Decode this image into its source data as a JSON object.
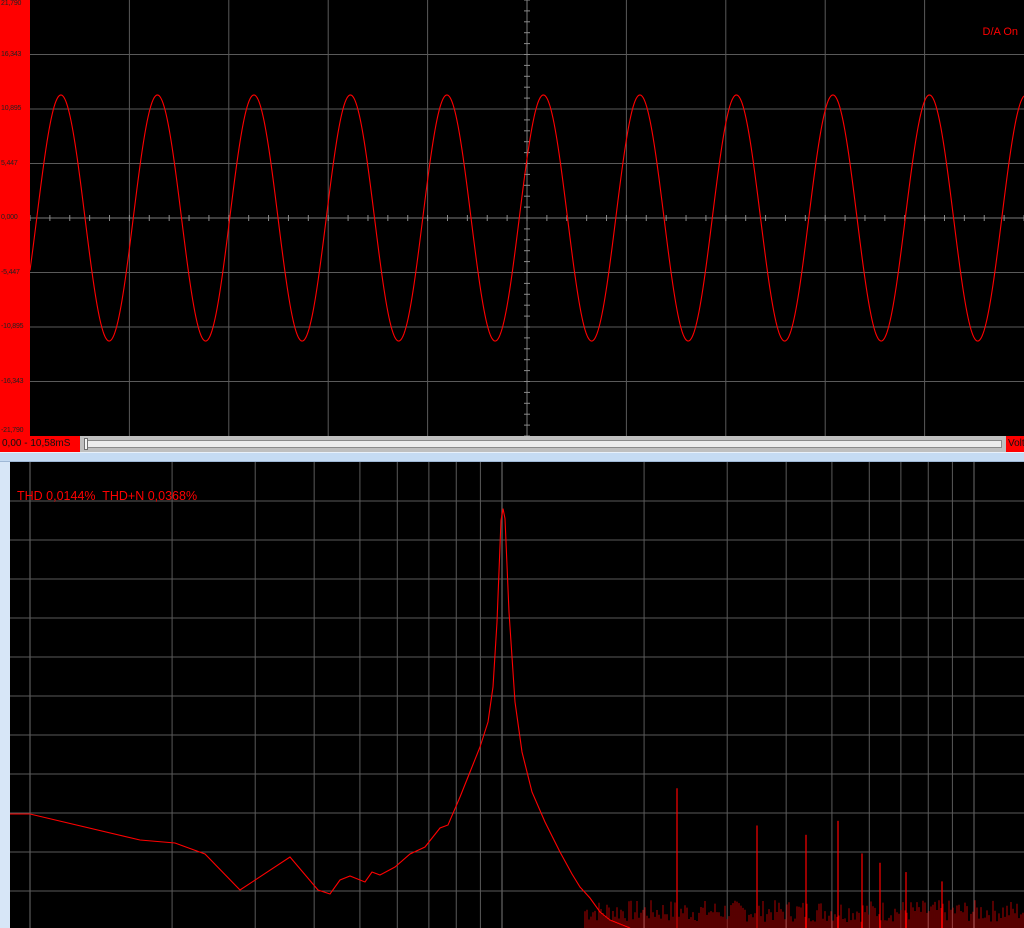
{
  "scope": {
    "y_ticks": [
      "21,790",
      "16,343",
      "10,895",
      "5,447",
      "0,000",
      "-5,447",
      "-10,895",
      "-16,343",
      "-21,790"
    ],
    "status": "D/A On",
    "time_range": "0,00 - 10,58mS",
    "units": "Volt",
    "time_scroll_position": 0.0
  },
  "spectrum": {
    "readout": "THD 0,0144%  THD+N 0,0368%"
  },
  "colors": {
    "trace": "#ff0000",
    "grid": "#5a5a5a",
    "axis_bar": "#ff0000",
    "splitter": "#c5dbf3"
  },
  "chart_data": [
    {
      "type": "line",
      "ylim": [
        -21.79,
        21.79
      ],
      "series": [
        {
          "waveform": "sine",
          "amplitude": 12.3,
          "cycles_visible": 10.3,
          "phase_cycles_at_left": 0.93
        }
      ],
      "grid": true
    },
    {
      "type": "line",
      "xscale": "log",
      "grid": true,
      "series": [
        {
          "fundamental_peak_level": 0.9,
          "harmonics_levels": [
            0.3,
            0.22,
            0.2,
            0.23,
            0.16,
            0.14,
            0.12,
            0.1
          ]
        }
      ]
    }
  ]
}
